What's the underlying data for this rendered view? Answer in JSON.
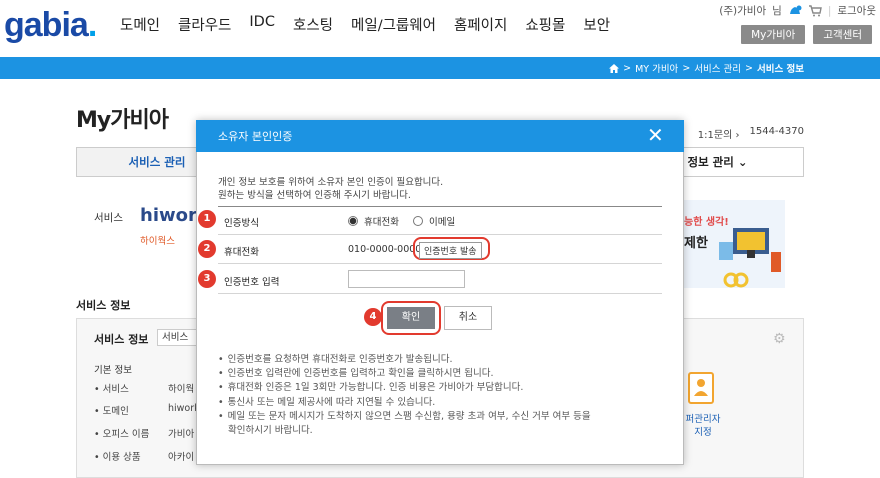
{
  "header": {
    "logo": "gabia",
    "logo_dot": ".",
    "nav": [
      "도메인",
      "클라우드",
      "IDC",
      "호스팅",
      "메일/그룹웨어",
      "홈페이지",
      "쇼핑몰",
      "보안"
    ],
    "user": "(주)가비아",
    "user_suffix": "님",
    "logout": "로그아웃",
    "my_gabia": "My가비아",
    "support": "고객센터"
  },
  "breadcrumb": [
    "MY 가비아",
    "서비스 관리",
    "서비스 정보"
  ],
  "page": {
    "title": "My가비아",
    "inquiry": "1:1문의",
    "phone": "1544-4370",
    "tab_service": "서비스 관리",
    "tab_info": "y 정보 관리",
    "service_label": "서비스",
    "service_logo": "hiwork",
    "service_logo_kr": "하이웍스",
    "banner_line1": "능한 생각!",
    "banner_line2": "제한",
    "service_info_title": "서비스 정보",
    "box_title": "서비스 정보",
    "box_select": "서비스",
    "basic_title": "기본 정보",
    "info_rows": [
      {
        "label": "서비스",
        "value": "하이웍"
      },
      {
        "label": "도메인",
        "value": "hiwork"
      },
      {
        "label": "오피스 이름",
        "value": "가비아"
      },
      {
        "label": "이용 상품",
        "value": "아카이"
      }
    ],
    "admin_line1": "퍼관리자",
    "admin_line2": "지정"
  },
  "modal": {
    "title": "소유자 본인인증",
    "desc": [
      "개인 정보 보호를 위하여 소유자 본인 인증이 필요합니다.",
      "원하는 방식을 선택하여 인증해 주시기 바랍니다."
    ],
    "method_label": "인증방식",
    "option_phone": "휴대전화",
    "option_email": "이메일",
    "phone_label": "휴대전화",
    "phone_value": "010-0000-0000",
    "send_btn": "인증번호 발송",
    "code_label": "인증번호 입력",
    "code_value": "",
    "confirm": "확인",
    "cancel": "취소",
    "step_numbers": [
      "1",
      "2",
      "3",
      "4"
    ],
    "notes": [
      "인증번호를 요청하면 휴대전화로 인증번호가 발송됩니다.",
      "인증번호 입력란에 인증번호를 입력하고 확인을 클릭하시면 됩니다.",
      "휴대전화 인증은 1일 3회만 가능합니다. 인증 비용은 가비아가 부담합니다.",
      "통신사 또는 메일 제공사에 따라 지연될 수 있습니다.",
      "메일 또는 문자 메시지가 도착하지 않으면 스팸 수신함, 용량 초과 여부, 수신 거부 여부 등을"
    ],
    "notes_cont": "확인하시기 바랍니다."
  },
  "colors": {
    "brand_blue": "#1c93e2",
    "highlight_red": "#e23a2e"
  }
}
